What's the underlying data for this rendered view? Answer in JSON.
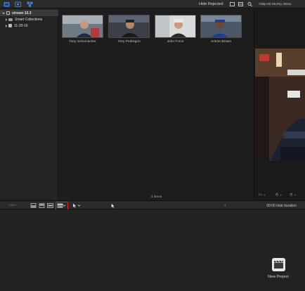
{
  "toolbar": {
    "icons": [
      "libraries-icon",
      "photos-icon",
      "titles-icon"
    ],
    "filter_label": "Hide Rejected",
    "format_label": "720p HD 29.97p, Mono"
  },
  "sidebar": {
    "items": [
      {
        "label": "stream 10.3",
        "icon": "library-icon",
        "expanded": true,
        "selected": true
      },
      {
        "label": "Smart Collections",
        "icon": "folder-icon",
        "expanded": false
      },
      {
        "label": "11-20-16",
        "icon": "event-icon",
        "expanded": false
      }
    ]
  },
  "browser": {
    "clips": [
      {
        "name": "Tony Schumacher"
      },
      {
        "name": "Tony Pedregon"
      },
      {
        "name": "John Force"
      },
      {
        "name": "Antron Brown"
      }
    ],
    "items_count": "4 items"
  },
  "timeline_toolbar": {
    "index_label": "Index",
    "duration": "00:00 total duration"
  },
  "timeline": {
    "new_project_label": "New Project"
  },
  "colors": {
    "highlight_box": "#e0221c",
    "accent_blue": "#3d7fe0"
  }
}
